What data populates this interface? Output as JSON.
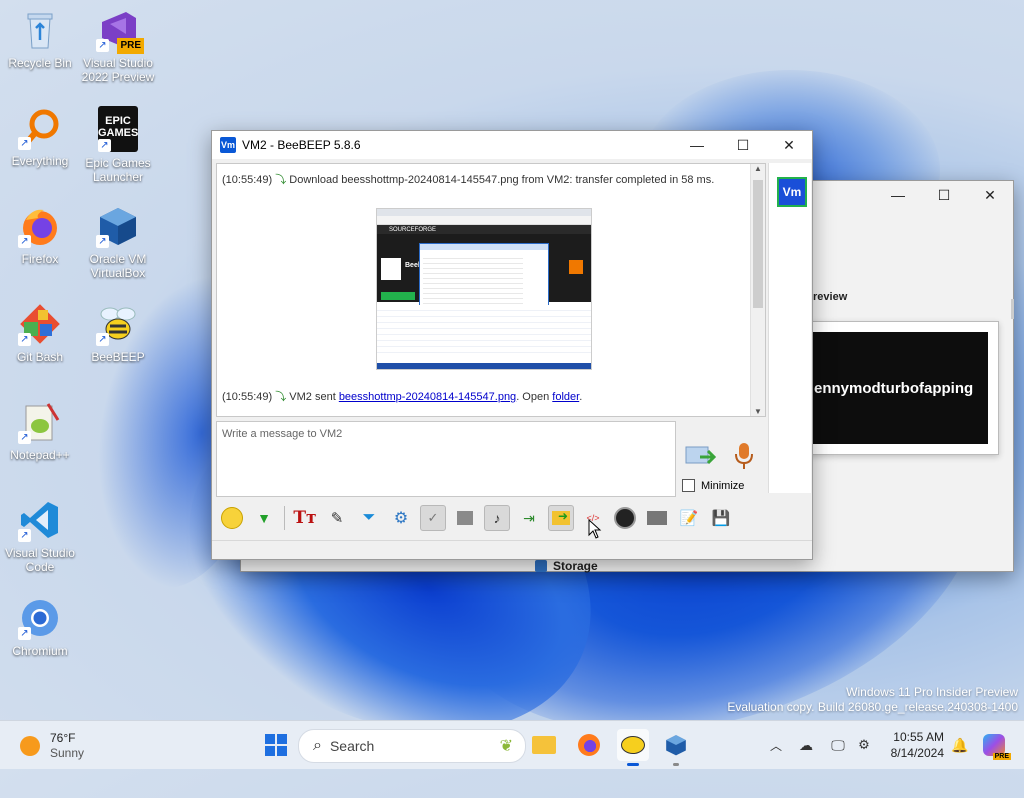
{
  "desktop": {
    "icons": [
      {
        "label": "Recycle Bin"
      },
      {
        "label": "Visual Studio 2022 Preview",
        "badge": "PRE"
      },
      {
        "label": "Everything"
      },
      {
        "label": "Epic Games Launcher",
        "logo_text": "EPIC\nGAMES"
      },
      {
        "label": "Firefox"
      },
      {
        "label": "Oracle VM VirtualBox"
      },
      {
        "label": "Git Bash"
      },
      {
        "label": "BeeBEEP"
      },
      {
        "label": "Notepad++"
      },
      {
        "label": "Visual Studio Code"
      },
      {
        "label": "Chromium"
      }
    ],
    "watermark": {
      "line1": "Windows 11 Pro Insider Preview",
      "line2": "Evaluation copy. Build 26080.ge_release.240308-1400"
    }
  },
  "back_window": {
    "preview_label": "review",
    "preview_text": "ennymodturbofapping",
    "storage_label": "Storage"
  },
  "chat_window": {
    "title": "VM2 - BeeBEEP 5.8.6",
    "app_icon_text": "Vm",
    "messages": [
      {
        "time": "(10:55:49)",
        "text": "Download beesshottmp-20240814-145547.png from VM2: transfer completed in 58 ms."
      },
      {
        "time": "(10:55:49)",
        "prefix": "VM2 sent",
        "link": "beesshottmp-20240814-145547.png",
        "middle": ". Open",
        "folder": "folder",
        "suffix": "."
      }
    ],
    "thumb": {
      "brand": "SOURCEFORGE",
      "caption": "Beeb"
    },
    "input_placeholder": "Write a message to VM2",
    "minimize_label": "Minimize",
    "user_badge": "Vm"
  },
  "taskbar": {
    "weather_temp": "76°F",
    "weather_desc": "Sunny",
    "search_placeholder": "Search",
    "time": "10:55 AM",
    "date": "8/14/2024",
    "badge": "PRE"
  },
  "colors": {
    "accent": "#0a58d6",
    "link": "#0000cc",
    "vm_badge": "#1a4fd8"
  }
}
